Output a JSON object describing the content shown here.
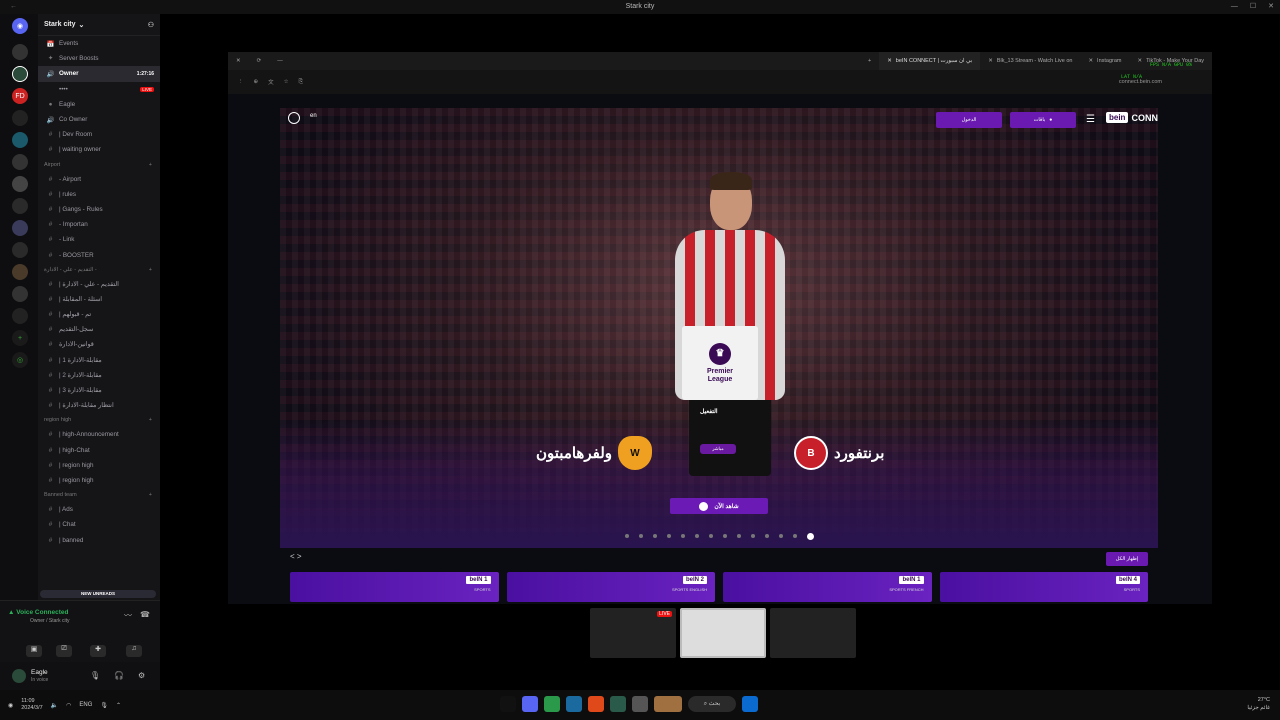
{
  "window": {
    "title": "Stark city"
  },
  "discord": {
    "guild_name": "Stark city",
    "items": [
      {
        "type": "ch",
        "icon": "📅",
        "label": "Events"
      },
      {
        "type": "ch",
        "icon": "✦",
        "label": "Server Boosts"
      },
      {
        "type": "ch",
        "icon": "🔊",
        "label": "Owner",
        "time": "1:27:16",
        "highlight": true
      },
      {
        "type": "ch",
        "icon": "",
        "label": "••••",
        "live": "LIVE"
      },
      {
        "type": "ch",
        "icon": "●",
        "label": "Eagle"
      },
      {
        "type": "ch",
        "icon": "🔊",
        "label": "Co Owner"
      },
      {
        "type": "ch",
        "icon": "#",
        "label": "| Dev Room"
      },
      {
        "type": "ch",
        "icon": "#",
        "label": "| waiting owner"
      },
      {
        "type": "cat",
        "label": "Airport"
      },
      {
        "type": "ch",
        "icon": "#",
        "label": "- Airport"
      },
      {
        "type": "ch",
        "icon": "#",
        "label": "| rules"
      },
      {
        "type": "ch",
        "icon": "#",
        "label": "| Gangs - Rules"
      },
      {
        "type": "ch",
        "icon": "#",
        "label": "- Importan"
      },
      {
        "type": "ch",
        "icon": "#",
        "label": "- Link"
      },
      {
        "type": "ch",
        "icon": "#",
        "label": "- BOOSTER"
      },
      {
        "type": "cat",
        "label": "التقديم - علي - الادارة -"
      },
      {
        "type": "ch",
        "icon": "#",
        "label": "| التقديم - علي - الادارة"
      },
      {
        "type": "ch",
        "icon": "#",
        "label": "| اسئلة - المقابلة"
      },
      {
        "type": "ch",
        "icon": "#",
        "label": "| تم - قبولهم"
      },
      {
        "type": "ch",
        "icon": "#",
        "label": "سجل-التقديم"
      },
      {
        "type": "ch",
        "icon": "#",
        "label": "قوانين-الادارة"
      },
      {
        "type": "ch",
        "icon": "#",
        "label": "| مقابلة-الادارة 1"
      },
      {
        "type": "ch",
        "icon": "#",
        "label": "| مقابلة-الادارة 2"
      },
      {
        "type": "ch",
        "icon": "#",
        "label": "| مقابلة-الادارة 3"
      },
      {
        "type": "ch",
        "icon": "#",
        "label": "| انتظار مقابلة-الادارة"
      },
      {
        "type": "cat",
        "label": "region high"
      },
      {
        "type": "ch",
        "icon": "#",
        "label": "| high-Announcement"
      },
      {
        "type": "ch",
        "icon": "#",
        "label": "| high-Chat"
      },
      {
        "type": "ch",
        "icon": "#",
        "label": "| region high"
      },
      {
        "type": "ch",
        "icon": "#",
        "label": "| region high"
      },
      {
        "type": "cat",
        "label": "Banned team"
      },
      {
        "type": "ch",
        "icon": "#",
        "label": "| Ads"
      },
      {
        "type": "ch",
        "icon": "#",
        "label": "| Chat"
      },
      {
        "type": "ch",
        "icon": "#",
        "label": "| banned"
      }
    ],
    "new_unreads": "NEW UNREADS",
    "voice_connected": "Voice Connected",
    "voice_sub": "Owner / Stark city",
    "user_name": "Eagle",
    "user_status": "In voice"
  },
  "browser": {
    "tabs": [
      {
        "label": "beIN CONNECT | بي ان سبورت",
        "active": true
      },
      {
        "label": "Blk_13 Stream - Watch Live on"
      },
      {
        "label": "Instagram"
      },
      {
        "label": "TikTok - Make Your Day"
      }
    ],
    "url": "connect.bein.com",
    "overlay_fps": "FPS N/A  GPU 0%",
    "overlay_lat": "LAT N/A"
  },
  "bein": {
    "lang": "en",
    "login": "الدخول",
    "card_label": "باقات",
    "logo_word": "CONNECT",
    "pl_line1": "Premier",
    "pl_line2": "League",
    "pl_label": "التفعيل",
    "team_left": "ولفرهامبتون",
    "team_right": "برنتفورد",
    "live_pill": "مباشر",
    "watch_now": "شاهد الآن",
    "see_all": "إظهار الكل",
    "channels": [
      {
        "logo": "beIN 1",
        "sub": "SPORTS"
      },
      {
        "logo": "beIN 2",
        "sub": "SPORTS ENGLISH"
      },
      {
        "logo": "beIN 1",
        "sub": "SPORTS FRENCH"
      },
      {
        "logo": "beIN 4",
        "sub": "SPORTS"
      }
    ],
    "slide_count": 14,
    "active_slide": 14
  },
  "stream_thumbs": [
    {
      "live": "LIVE"
    },
    {},
    {}
  ],
  "taskbar": {
    "left_time": "11:09",
    "left_date": "2024/3/7",
    "lang": "ENG",
    "search": "بحث",
    "weather": "27°C",
    "weather_sub": "غائم جزئيا"
  },
  "colors": {
    "accent": "#6b1ab5",
    "brand": "#3a0a55",
    "live": "#e11"
  }
}
